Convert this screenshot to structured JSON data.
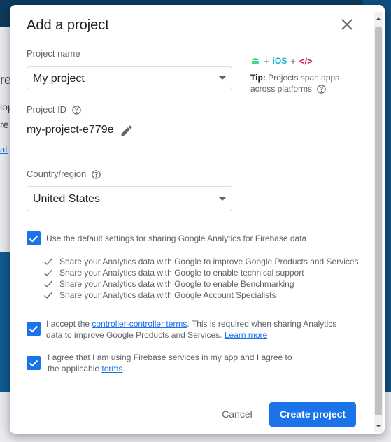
{
  "dialog": {
    "title": "Add a project",
    "project_name_label": "Project name",
    "project_name_value": "My project",
    "project_id_label": "Project ID",
    "project_id_value": "my-project-e779e",
    "country_label": "Country/region",
    "country_value": "United States",
    "platforms": {
      "ios_text": "iOS",
      "code_text": "</>",
      "tip_bold": "Tip:",
      "tip_text": "Projects span apps across platforms"
    },
    "analytics_checkbox_label": "Use the default settings for sharing Google Analytics for Firebase data",
    "share_items": [
      "Share your Analytics data with Google to improve Google Products and Services",
      "Share your Analytics data with Google to enable technical support",
      "Share your Analytics data with Google to enable Benchmarking",
      "Share your Analytics data with Google Account Specialists"
    ],
    "terms1_prefix": "I accept the ",
    "terms1_link": "controller-controller terms",
    "terms1_middle": ". This is required when sharing Analytics data to improve Google Products and Services. ",
    "terms1_learn_more": "Learn more",
    "terms2_prefix": "I agree that I am using Firebase services in my app and I agree to the applicable ",
    "terms2_link": "terms",
    "terms2_suffix": ".",
    "cancel_label": "Cancel",
    "create_label": "Create project"
  },
  "background": {
    "fragment_1": "re",
    "fragment_2": "lop",
    "fragment_3": "re",
    "fragment_4": "at"
  },
  "colors": {
    "accent": "#1a73e8",
    "android": "#3ddc84",
    "ios": "#12b5cb",
    "code": "#c2185b"
  }
}
